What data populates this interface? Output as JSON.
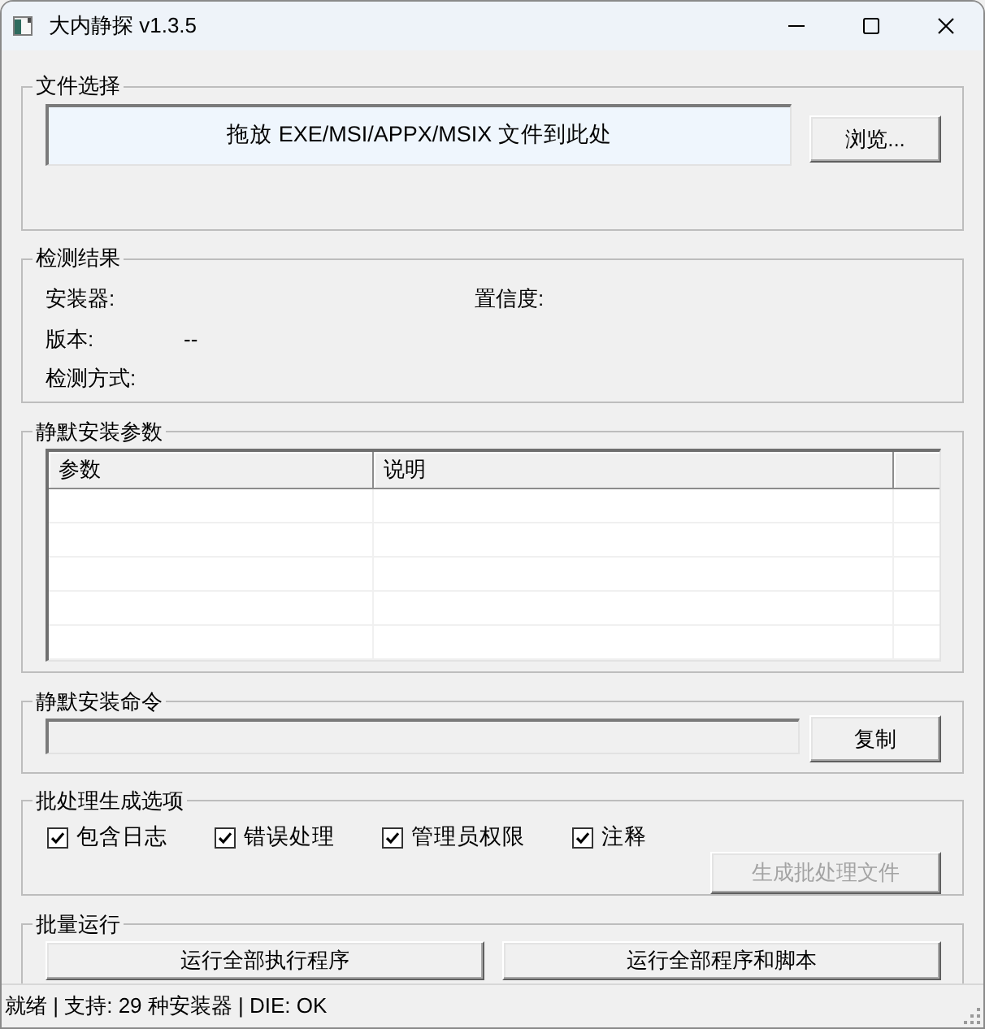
{
  "window": {
    "title": "大内静探 v1.3.5"
  },
  "file_selection": {
    "title": "文件选择",
    "drop_zone": "拖放 EXE/MSI/APPX/MSIX 文件到此处",
    "browse_button": "浏览..."
  },
  "detection_result": {
    "title": "检测结果",
    "rows": [
      [
        {
          "label": "安装器:"
        },
        {
          "label": "置信度:"
        }
      ],
      [
        {
          "label": "版本:",
          "value": "--"
        }
      ],
      [
        {
          "label": "检测方式:"
        }
      ]
    ]
  },
  "silent_params": {
    "title": "静默安装参数",
    "table": {
      "columns": [
        "参数",
        "说明"
      ]
    }
  },
  "silent_command": {
    "title": "静默安装命令",
    "command_field": {
      "readonly": true
    },
    "copy_button": "复制"
  },
  "batch_options": {
    "title": "批处理生成选项",
    "options": [
      {
        "label": "包含日志",
        "checked": true
      },
      {
        "label": "错误处理",
        "checked": true
      },
      {
        "label": "管理员权限",
        "checked": true
      },
      {
        "label": "注释",
        "checked": true
      }
    ],
    "generate_button": {
      "label": "生成批处理文件",
      "disabled": true
    }
  },
  "batch_run": {
    "title": "批量运行",
    "buttons": [
      "运行全部执行程序",
      "运行全部程序和脚本"
    ]
  },
  "status_bar": {
    "text": "就绪 | 支持: 29 种安装器 | DIE: OK"
  }
}
